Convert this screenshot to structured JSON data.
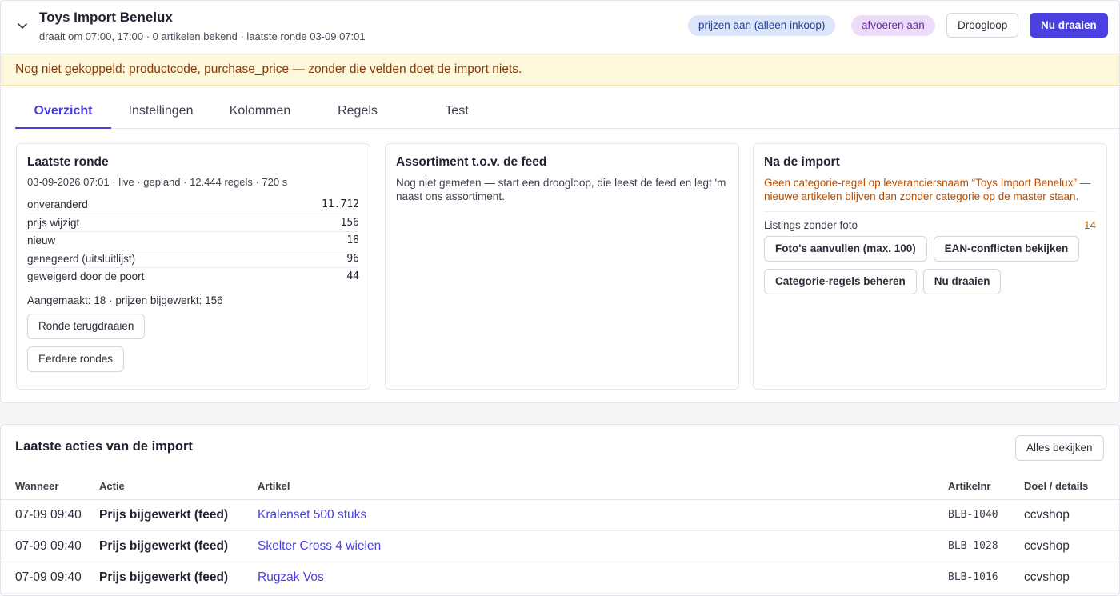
{
  "header": {
    "title": "Toys Import Benelux",
    "subtitle": "draait om 07:00, 17:00 · 0 artikelen bekend · laatste ronde 03-09 07:01",
    "badges": [
      "prijzen aan (alleen inkoop)",
      "afvoeren aan"
    ],
    "dry_run_label": "Droogloop",
    "run_now_label": "Nu draaien"
  },
  "warning": "Nog niet gekoppeld: productcode, purchase_price — zonder die velden doet de import niets.",
  "tabs": [
    "Overzicht",
    "Instellingen",
    "Kolommen",
    "Regels",
    "Test"
  ],
  "last_round": {
    "title": "Laatste ronde",
    "meta": "03-09-2026 07:01 · live · gepland · 12.444 regels · 720 s",
    "rows": [
      {
        "label": "onveranderd",
        "value": "11.712"
      },
      {
        "label": "prijs wijzigt",
        "value": "156"
      },
      {
        "label": "nieuw",
        "value": "18"
      },
      {
        "label": "genegeerd (uitsluitlijst)",
        "value": "96"
      },
      {
        "label": "geweigerd door de poort",
        "value": "44"
      }
    ],
    "summary": "Aangemaakt: 18 · prijzen bijgewerkt: 156",
    "rollback_label": "Ronde terugdraaien",
    "earlier_label": "Eerdere rondes"
  },
  "assortment": {
    "title": "Assortiment t.o.v. de feed",
    "text": "Nog niet gemeten — start een droogloop, die leest de feed en legt 'm naast ons assortiment."
  },
  "after_import": {
    "title": "Na de import",
    "warning": "Geen categorie-regel op leveranciersnaam “Toys Import Benelux” — nieuwe artikelen blijven dan zonder categorie op de master staan.",
    "photo_label": "Listings zonder foto",
    "photo_count": "14",
    "buttons": [
      "Foto's aanvullen (max. 100)",
      "EAN-conflicten bekijken",
      "Categorie-regels beheren",
      "Nu draaien"
    ]
  },
  "actions": {
    "title": "Laatste acties van de import",
    "view_all_label": "Alles bekijken",
    "columns": [
      "Wanneer",
      "Actie",
      "Artikel",
      "Artikelnr",
      "Doel / details"
    ],
    "rows": [
      {
        "when": "07-09 09:40",
        "action": "Prijs bijgewerkt (feed)",
        "article": "Kralenset 500 stuks",
        "sku": "BLB-1040",
        "target": "ccvshop"
      },
      {
        "when": "07-09 09:40",
        "action": "Prijs bijgewerkt (feed)",
        "article": "Skelter Cross 4 wielen",
        "sku": "BLB-1028",
        "target": "ccvshop"
      },
      {
        "when": "07-09 09:40",
        "action": "Prijs bijgewerkt (feed)",
        "article": "Rugzak Vos",
        "sku": "BLB-1016",
        "target": "ccvshop"
      }
    ]
  }
}
